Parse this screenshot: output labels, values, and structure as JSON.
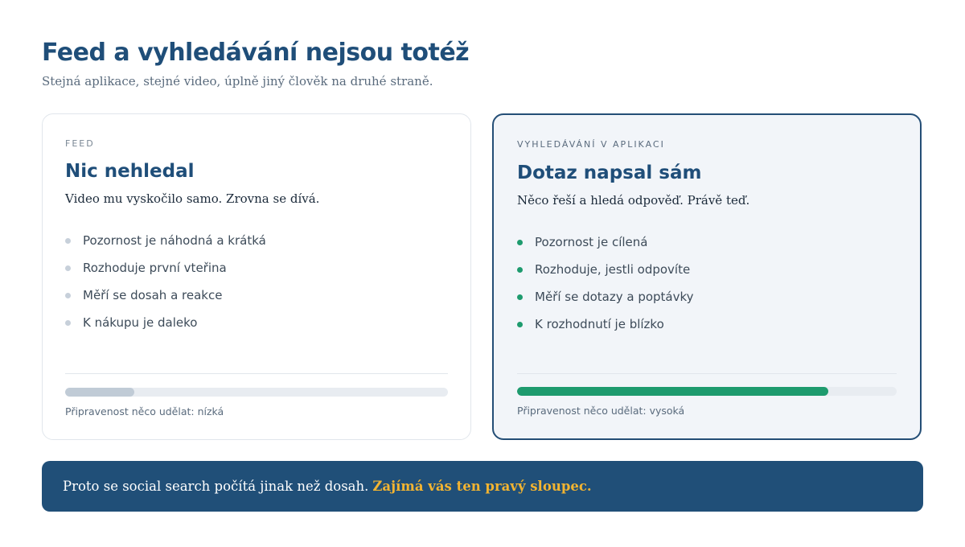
{
  "header": {
    "title": "Feed a vyhledávání nejsou totéž",
    "subtitle": "Stejná aplikace, stejné video, úplně jiný člověk na druhé straně."
  },
  "cards": [
    {
      "eyebrow": "FEED",
      "heading": "Nic nehledal",
      "lede": "Video mu vyskočilo samo. Zrovna se dívá.",
      "items": [
        "Pozornost je náhodná a krátká",
        "Rozhoduje první vteřina",
        "Měří se dosah a reakce",
        "K nákupu je daleko"
      ],
      "bullet_color": "#c7d0da",
      "readiness_fraction": 0.18,
      "readiness_color": "#c0cbd6",
      "readiness_label": "Připravenost něco udělat: nízká"
    },
    {
      "eyebrow": "VYHLEDÁVÁNÍ V APLIKACI",
      "heading": "Dotaz napsal sám",
      "lede": "Něco řeší a hledá odpověď. Právě teď.",
      "items": [
        "Pozornost je cílená",
        "Rozhoduje, jestli odpovíte",
        "Měří se dotazy a poptávky",
        "K rozhodnutí je blízko"
      ],
      "bullet_color": "#1e9b6e",
      "readiness_fraction": 0.82,
      "readiness_color": "#1e9b6e",
      "readiness_label": "Připravenost něco udělat: vysoká"
    }
  ],
  "banner": {
    "text": "Proto se social search počítá jinak než dosah.",
    "highlight": "Zajímá vás ten pravý sloupec.",
    "highlight_color": "#f2b431"
  }
}
